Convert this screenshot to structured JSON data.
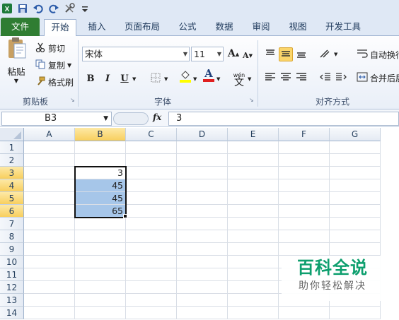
{
  "qat": {
    "icons": [
      "excel-icon",
      "save-icon",
      "undo-icon",
      "redo-icon",
      "tools-icon",
      "customize-icon"
    ]
  },
  "tabs": [
    {
      "label": "文件"
    },
    {
      "label": "开始"
    },
    {
      "label": "插入"
    },
    {
      "label": "页面布局"
    },
    {
      "label": "公式"
    },
    {
      "label": "数据"
    },
    {
      "label": "审阅"
    },
    {
      "label": "视图"
    },
    {
      "label": "开发工具"
    }
  ],
  "clipboard": {
    "paste": "粘贴",
    "cut": "剪切",
    "copy": "复制",
    "format_painter": "格式刷",
    "group": "剪贴板"
  },
  "font": {
    "name": "宋体",
    "size": "11",
    "group": "字体",
    "bold": "B",
    "italic": "I",
    "underline": "U",
    "grow": "A",
    "shrink": "A",
    "wen": "wén",
    "wen_char": "文"
  },
  "alignment": {
    "wrap": "自动换行",
    "merge": "合并后居",
    "group": "对齐方式"
  },
  "formula_bar": {
    "name_box": "B3",
    "fx": "fx",
    "value": "3"
  },
  "columns": [
    "A",
    "B",
    "C",
    "D",
    "E",
    "F",
    "G"
  ],
  "selected_column": "B",
  "rows": [
    "1",
    "2",
    "3",
    "4",
    "5",
    "6",
    "7",
    "8",
    "9",
    "10",
    "11",
    "12",
    "13",
    "14"
  ],
  "selected_rows": [
    "3",
    "4",
    "5",
    "6"
  ],
  "cells": {
    "B3": "3",
    "B4": "45",
    "B5": "45",
    "B6": "65"
  },
  "colors": {
    "file_tab": "#2f7d32",
    "selection": "#a6c6e9",
    "header_selected": "#f8cf5e"
  },
  "watermark": {
    "title": "百科全说",
    "subtitle": "助你轻松解决"
  }
}
